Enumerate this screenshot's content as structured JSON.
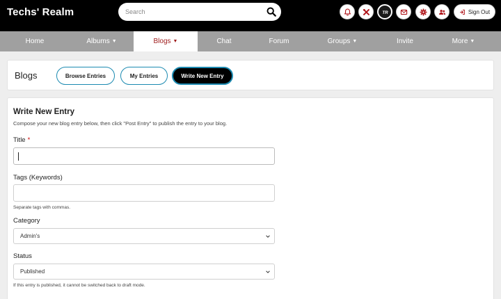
{
  "header": {
    "site_title": "Techs' Realm",
    "search_placeholder": "Search",
    "icons": [
      "bell-icon",
      "tools-icon",
      "site-logo-icon",
      "mail-icon",
      "gear-icon",
      "users-icon"
    ],
    "logo_text": "TR",
    "signout_label": "Sign Out"
  },
  "nav": {
    "items": [
      {
        "label": "Home"
      },
      {
        "label": "Albums"
      },
      {
        "label": "Blogs"
      },
      {
        "label": "Chat"
      },
      {
        "label": "Forum"
      },
      {
        "label": "Groups"
      },
      {
        "label": "Invite"
      },
      {
        "label": "More"
      }
    ],
    "active": "Blogs",
    "active_color": "#9e1b1b"
  },
  "blogs_bar": {
    "title": "Blogs",
    "buttons": [
      "Browse Entries",
      "My Entries",
      "Write New Entry"
    ],
    "accent": "#1b8ab1"
  },
  "form": {
    "heading": "Write New Entry",
    "description": "Compose your new blog entry below, then click \"Post Entry\" to publish the entry to your blog.",
    "title_label": "Title",
    "required_mark": "*",
    "title_value": "",
    "tags_label": "Tags (Keywords)",
    "tags_value": "",
    "tags_help": "Separate tags with commas.",
    "category_label": "Category",
    "category_value": "Admin's",
    "status_label": "Status",
    "status_value": "Published",
    "status_help": "If this entry is published, it cannot be switched back to draft mode."
  }
}
